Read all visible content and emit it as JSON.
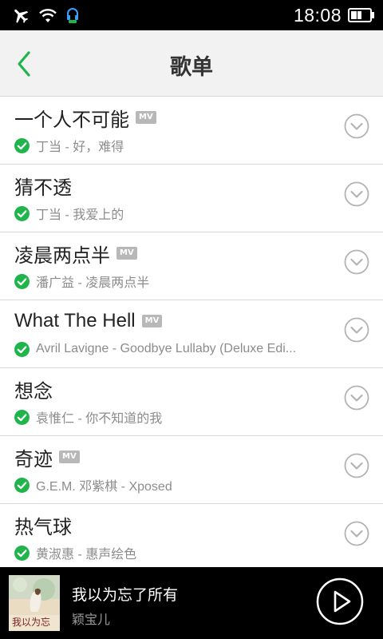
{
  "status_bar": {
    "time": "18:08",
    "icons": [
      "airplane-icon",
      "wifi-icon",
      "headset-notification-icon",
      "battery-icon"
    ]
  },
  "header": {
    "title": "歌单",
    "back_icon": "chevron-left-icon"
  },
  "songs": [
    {
      "title": "一个人不可能",
      "mv": "MV",
      "subtitle": "丁当 - 好，难得"
    },
    {
      "title": "猜不透",
      "mv": "",
      "subtitle": "丁当 - 我爱上的"
    },
    {
      "title": "凌晨两点半",
      "mv": "MV",
      "subtitle": "潘广益 - 凌晨两点半"
    },
    {
      "title": "What The Hell",
      "mv": "MV",
      "subtitle": "Avril Lavigne - Goodbye Lullaby (Deluxe Edi..."
    },
    {
      "title": "想念",
      "mv": "",
      "subtitle": "袁惟仁 - 你不知道的我"
    },
    {
      "title": "奇迹",
      "mv": "MV",
      "subtitle": "G.E.M. 邓紫棋 - Xposed"
    },
    {
      "title": "热气球",
      "mv": "",
      "subtitle": "黄淑惠 - 惠声绘色"
    }
  ],
  "player": {
    "title": "我以为忘了所有",
    "artist": "颖宝儿",
    "album_art_text": "我以为忘"
  },
  "colors": {
    "accent_green": "#1fb54a",
    "status_bar_bg": "#000000",
    "header_bg": "#f2f2f2",
    "player_bg": "#000000"
  }
}
